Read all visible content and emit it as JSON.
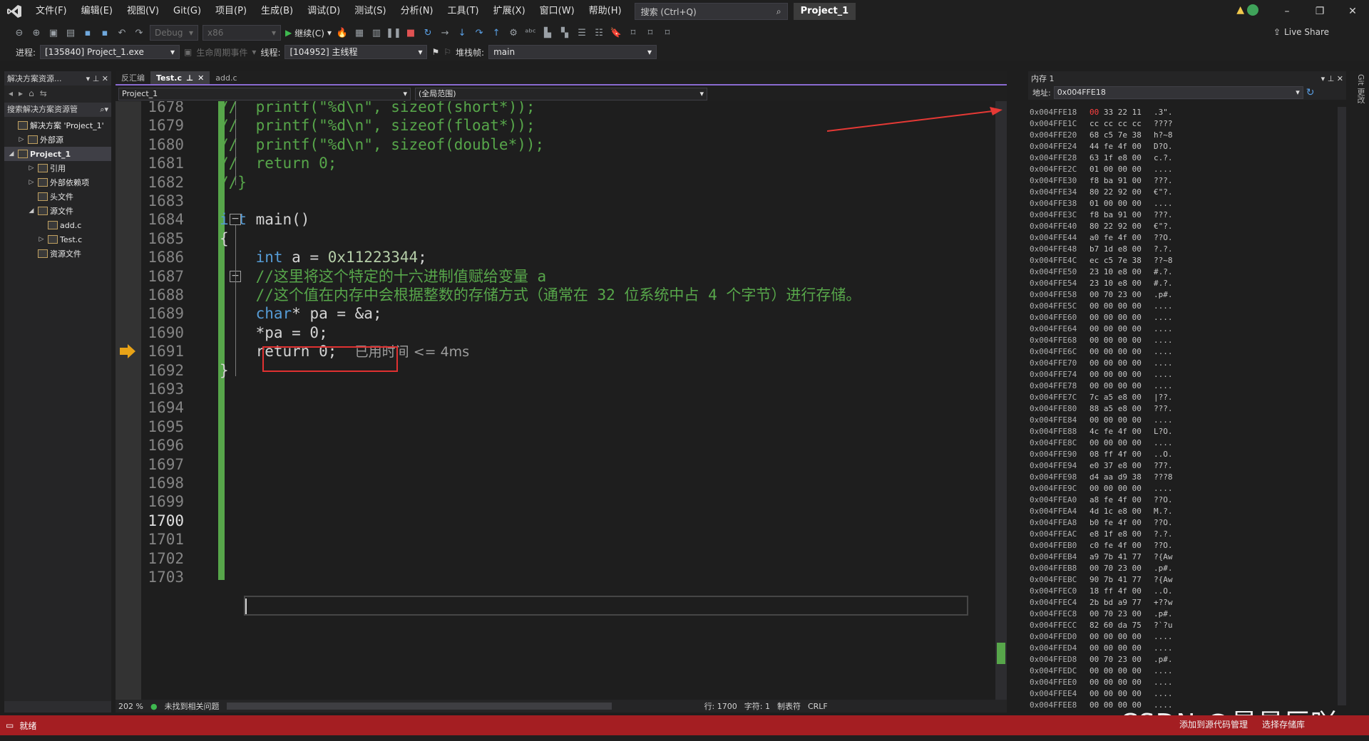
{
  "menu": [
    "文件(F)",
    "编辑(E)",
    "视图(V)",
    "Git(G)",
    "项目(P)",
    "生成(B)",
    "调试(D)",
    "测试(S)",
    "分析(N)",
    "工具(T)",
    "扩展(X)",
    "窗口(W)",
    "帮助(H)"
  ],
  "search_placeholder": "搜索 (Ctrl+Q)",
  "project_badge": "Project_1",
  "toolbar": {
    "config": "Debug",
    "platform": "x86",
    "continue": "继续(C)",
    "live_share": "Live Share"
  },
  "debugbar": {
    "process_label": "进程:",
    "process": "[135840] Project_1.exe",
    "lifecycle": "生命周期事件",
    "thread_label": "线程:",
    "thread": "[104952] 主线程",
    "stack_label": "堆栈帧:",
    "stack": "main"
  },
  "solution": {
    "title": "解决方案资源...",
    "search": "搜索解决方案资源管",
    "items": [
      {
        "label": "解决方案 'Project_1'",
        "indent": 0,
        "twisty": ""
      },
      {
        "label": "外部源",
        "indent": 1,
        "twisty": "▷"
      },
      {
        "label": "Project_1",
        "indent": 0,
        "twisty": "◢",
        "selected": true
      },
      {
        "label": "引用",
        "indent": 2,
        "twisty": "▷"
      },
      {
        "label": "外部依赖项",
        "indent": 2,
        "twisty": "▷"
      },
      {
        "label": "头文件",
        "indent": 2,
        "twisty": ""
      },
      {
        "label": "源文件",
        "indent": 2,
        "twisty": "◢"
      },
      {
        "label": "add.c",
        "indent": 3,
        "twisty": ""
      },
      {
        "label": "Test.c",
        "indent": 3,
        "twisty": "▷"
      },
      {
        "label": "资源文件",
        "indent": 2,
        "twisty": ""
      }
    ]
  },
  "tabs": [
    {
      "label": "反汇编",
      "active": false
    },
    {
      "label": "Test.c",
      "active": true
    },
    {
      "label": "add.c",
      "active": false
    }
  ],
  "navbar": {
    "project": "Project_1",
    "scope": "(全局范围)"
  },
  "code_lines": [
    {
      "n": "1678",
      "code": "//  printf(\"%d\\n\", sizeof(short*));",
      "cls": "cm"
    },
    {
      "n": "1679",
      "code": "//  printf(\"%d\\n\", sizeof(float*));",
      "cls": "cm"
    },
    {
      "n": "1680",
      "code": "//  printf(\"%d\\n\", sizeof(double*));",
      "cls": "cm"
    },
    {
      "n": "1681",
      "code": "//  return 0;",
      "cls": "cm"
    },
    {
      "n": "1682",
      "code": "//}",
      "cls": "cm"
    },
    {
      "n": "1683",
      "code": "",
      "cls": ""
    },
    {
      "n": "1684",
      "code": "",
      "cls": "main"
    },
    {
      "n": "1685",
      "code": "{",
      "cls": ""
    },
    {
      "n": "1686",
      "code": "",
      "cls": "inta"
    },
    {
      "n": "1687",
      "code": "    //这里将这个特定的十六进制值赋给变量 a",
      "cls": "cm"
    },
    {
      "n": "1688",
      "code": "    //这个值在内存中会根据整数的存储方式（通常在 32 位系统中占 4 个字节）进行存储。",
      "cls": "cm"
    },
    {
      "n": "1689",
      "code": "",
      "cls": "charpa"
    },
    {
      "n": "1690",
      "code": "    *pa = 0;",
      "cls": "pa0"
    },
    {
      "n": "1691",
      "code": "",
      "cls": "ret"
    },
    {
      "n": "1692",
      "code": "}",
      "cls": ""
    },
    {
      "n": "1693",
      "code": "",
      "cls": ""
    },
    {
      "n": "1694",
      "code": "",
      "cls": ""
    },
    {
      "n": "1695",
      "code": "",
      "cls": ""
    },
    {
      "n": "1696",
      "code": "",
      "cls": ""
    },
    {
      "n": "1697",
      "code": "",
      "cls": ""
    },
    {
      "n": "1698",
      "code": "",
      "cls": ""
    },
    {
      "n": "1699",
      "code": "",
      "cls": ""
    },
    {
      "n": "1700",
      "code": "",
      "cls": "cur"
    },
    {
      "n": "1701",
      "code": "",
      "cls": ""
    },
    {
      "n": "1702",
      "code": "",
      "cls": ""
    },
    {
      "n": "1703",
      "code": "",
      "cls": ""
    }
  ],
  "code_parts": {
    "int_kw": "int",
    "main_sig": " main()",
    "int_a": "int",
    "a_assign": " a = ",
    "a_value": "0x11223344",
    "semicolon": ";",
    "char_kw": "char",
    "pa_decl": "* pa = &a;",
    "return_kw": "return",
    "return_val": " 0;",
    "elapsed_hint": "已用时间 <= 4ms"
  },
  "editor_status": {
    "zoom": "202 %",
    "issues": "未找到相关问题",
    "line": "行: 1700",
    "char": "字符: 1",
    "tab": "制表符",
    "eol": "CRLF"
  },
  "memory": {
    "title": "内存 1",
    "address_label": "地址:",
    "address": "0x004FFE18",
    "rows": [
      [
        "0x004FFE18",
        "00",
        "33 22 11",
        ".3\"."
      ],
      [
        "0x004FFE1C",
        "",
        "cc cc cc cc",
        "????"
      ],
      [
        "0x004FFE20",
        "",
        "68 c5 7e 38",
        "h?~8"
      ],
      [
        "0x004FFE24",
        "",
        "44 fe 4f 00",
        "D?O."
      ],
      [
        "0x004FFE28",
        "",
        "63 1f e8 00",
        "c.?."
      ],
      [
        "0x004FFE2C",
        "",
        "01 00 00 00",
        "...."
      ],
      [
        "0x004FFE30",
        "",
        "f8 ba 91 00",
        "???."
      ],
      [
        "0x004FFE34",
        "",
        "80 22 92 00",
        "€\"?."
      ],
      [
        "0x004FFE38",
        "",
        "01 00 00 00",
        "...."
      ],
      [
        "0x004FFE3C",
        "",
        "f8 ba 91 00",
        "???."
      ],
      [
        "0x004FFE40",
        "",
        "80 22 92 00",
        "€\"?."
      ],
      [
        "0x004FFE44",
        "",
        "a0 fe 4f 00",
        "??O."
      ],
      [
        "0x004FFE48",
        "",
        "b7 1d e8 00",
        "?.?."
      ],
      [
        "0x004FFE4C",
        "",
        "ec c5 7e 38",
        "??~8"
      ],
      [
        "0x004FFE50",
        "",
        "23 10 e8 00",
        "#.?."
      ],
      [
        "0x004FFE54",
        "",
        "23 10 e8 00",
        "#.?."
      ],
      [
        "0x004FFE58",
        "",
        "00 70 23 00",
        ".p#."
      ],
      [
        "0x004FFE5C",
        "",
        "00 00 00 00",
        "...."
      ],
      [
        "0x004FFE60",
        "",
        "00 00 00 00",
        "...."
      ],
      [
        "0x004FFE64",
        "",
        "00 00 00 00",
        "...."
      ],
      [
        "0x004FFE68",
        "",
        "00 00 00 00",
        "...."
      ],
      [
        "0x004FFE6C",
        "",
        "00 00 00 00",
        "...."
      ],
      [
        "0x004FFE70",
        "",
        "00 00 00 00",
        "...."
      ],
      [
        "0x004FFE74",
        "",
        "00 00 00 00",
        "...."
      ],
      [
        "0x004FFE78",
        "",
        "00 00 00 00",
        "...."
      ],
      [
        "0x004FFE7C",
        "",
        "7c a5 e8 00",
        "|??."
      ],
      [
        "0x004FFE80",
        "",
        "88 a5 e8 00",
        "???."
      ],
      [
        "0x004FFE84",
        "",
        "00 00 00 00",
        "...."
      ],
      [
        "0x004FFE88",
        "",
        "4c fe 4f 00",
        "L?O."
      ],
      [
        "0x004FFE8C",
        "",
        "00 00 00 00",
        "...."
      ],
      [
        "0x004FFE90",
        "",
        "08 ff 4f 00",
        "..O."
      ],
      [
        "0x004FFE94",
        "",
        "e0 37 e8 00",
        "?7?."
      ],
      [
        "0x004FFE98",
        "",
        "d4 aa d9 38",
        "???8"
      ],
      [
        "0x004FFE9C",
        "",
        "00 00 00 00",
        "...."
      ],
      [
        "0x004FFEA0",
        "",
        "a8 fe 4f 00",
        "??O."
      ],
      [
        "0x004FFEA4",
        "",
        "4d 1c e8 00",
        "M.?."
      ],
      [
        "0x004FFEA8",
        "",
        "b0 fe 4f 00",
        "??O."
      ],
      [
        "0x004FFEAC",
        "",
        "e8 1f e8 00",
        "?.?."
      ],
      [
        "0x004FFEB0",
        "",
        "c0 fe 4f 00",
        "??O."
      ],
      [
        "0x004FFEB4",
        "",
        "a9 7b 41 77",
        "?{Aw"
      ],
      [
        "0x004FFEB8",
        "",
        "00 70 23 00",
        ".p#."
      ],
      [
        "0x004FFEBC",
        "",
        "90 7b 41 77",
        "?{Aw"
      ],
      [
        "0x004FFEC0",
        "",
        "18 ff 4f 00",
        "..O."
      ],
      [
        "0x004FFEC4",
        "",
        "2b bd a9 77",
        "+??w"
      ],
      [
        "0x004FFEC8",
        "",
        "00 70 23 00",
        ".p#."
      ],
      [
        "0x004FFECC",
        "",
        "82 60 da 75",
        "?`?u"
      ],
      [
        "0x004FFED0",
        "",
        "00 00 00 00",
        "...."
      ],
      [
        "0x004FFED4",
        "",
        "00 00 00 00",
        "...."
      ],
      [
        "0x004FFED8",
        "",
        "00 70 23 00",
        ".p#."
      ],
      [
        "0x004FFEDC",
        "",
        "00 00 00 00",
        "...."
      ],
      [
        "0x004FFEE0",
        "",
        "00 00 00 00",
        "...."
      ],
      [
        "0x004FFEE4",
        "",
        "00 00 00 00",
        "...."
      ],
      [
        "0x004FFEE8",
        "",
        "00 00 00 00",
        "...."
      ]
    ]
  },
  "side_label": "Git 更改",
  "statusbar": {
    "ready": "就绪",
    "source_control": "添加到源代码管理",
    "repo": "选择存储库"
  },
  "watermark": "CSDN @是星辰吖~",
  "colors": {
    "accent": "#8a6bd1",
    "statusbar": "#a41e22",
    "highlight_box": "#e03131",
    "change_bar": "#57a64a"
  }
}
